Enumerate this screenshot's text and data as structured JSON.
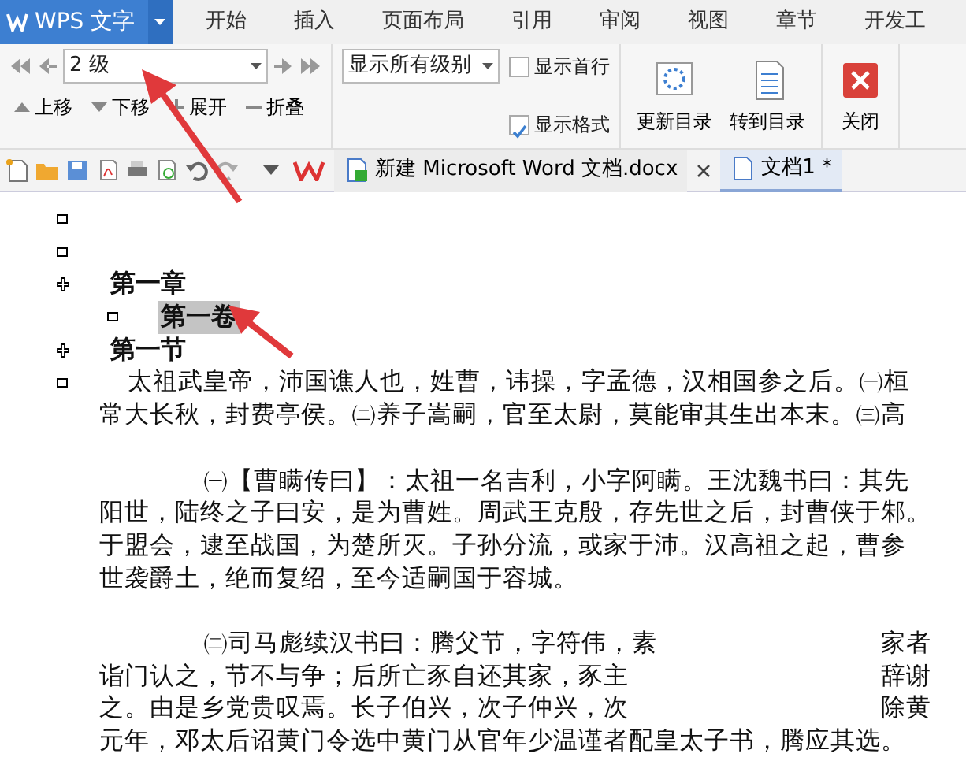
{
  "app_menu": {
    "label": "WPS 文字"
  },
  "tabs": [
    {
      "label": "开始",
      "selected": false
    },
    {
      "label": "插入",
      "selected": false
    },
    {
      "label": "页面布局",
      "selected": false
    },
    {
      "label": "引用",
      "selected": false
    },
    {
      "label": "审阅",
      "selected": false
    },
    {
      "label": "视图",
      "selected": false
    },
    {
      "label": "章节",
      "selected": false
    },
    {
      "label": "开发工",
      "selected": false
    }
  ],
  "outline_toolbar": {
    "level_select": "2 级",
    "move_buttons": [
      {
        "kind": "up",
        "label": "上移"
      },
      {
        "kind": "down",
        "label": "下移"
      },
      {
        "kind": "expand",
        "label": "展开"
      },
      {
        "kind": "collapse",
        "label": "折叠"
      }
    ],
    "show_level_select": "显示所有级别",
    "checkboxes": [
      {
        "label": "显示首行",
        "checked": false
      },
      {
        "label": "显示格式",
        "checked": true
      }
    ],
    "big_buttons": [
      {
        "kind": "update",
        "label": "更新目录"
      },
      {
        "kind": "goto",
        "label": "转到目录"
      },
      {
        "kind": "close",
        "label": "关闭"
      }
    ]
  },
  "doc_tabs": [
    {
      "label": "新建 Microsoft Word 文档.docx",
      "selected": false,
      "closable": true
    },
    {
      "label": "文档1 *",
      "selected": true,
      "closable": false
    }
  ],
  "outline": [
    {
      "kind": "empty"
    },
    {
      "kind": "empty"
    },
    {
      "kind": "heading",
      "text": "第一章",
      "selected": false,
      "expandable": true,
      "children": [
        {
          "kind": "heading",
          "text": "第一卷",
          "selected": true,
          "expandable": false
        }
      ]
    },
    {
      "kind": "heading",
      "text": "第一节",
      "selected": false,
      "expandable": true
    },
    {
      "kind": "body",
      "paragraphs": [
        {
          "kind": "main",
          "lines": [
            [
              "太祖武皇帝，沛国谯人也，姓曹，讳操，字孟德，汉相国参之后。㈠桓"
            ],
            [
              "常大长秋，封费亭侯。㈡养子嵩嗣，官至太尉，莫能审其生出本末。㈢高"
            ]
          ]
        },
        {
          "kind": "note",
          "lines": [
            [
              "㈠【曹瞒传曰】：太祖一名吉利，小字阿瞒。王沈魏书曰：其先"
            ],
            [
              "阳世，陆终之子曰安，是为曹姓。周武王克殷，存先世之后，封曹侠于邾。"
            ],
            [
              "于盟会，逮至战国，为楚所灭。子孙分流，或家于沛。汉高祖之起，曹参"
            ],
            [
              "世袭爵土，绝而复绍，至今适嗣国于容城。"
            ]
          ]
        },
        {
          "kind": "note",
          "lines": [
            [
              "㈡司马彪续汉书曰：腾父节，字符伟，素",
              "家者"
            ],
            [
              "诣门认之，节不与争；后所亡豕自还其家，豕主",
              "辞谢"
            ],
            [
              "之。由是乡党贵叹焉。长子伯兴，次子仲兴，次",
              "除黄"
            ],
            [
              "元年，邓太后诏黄门令选中黄门从官年少温谨者配皇太子书，腾应其选。"
            ]
          ]
        }
      ]
    }
  ]
}
